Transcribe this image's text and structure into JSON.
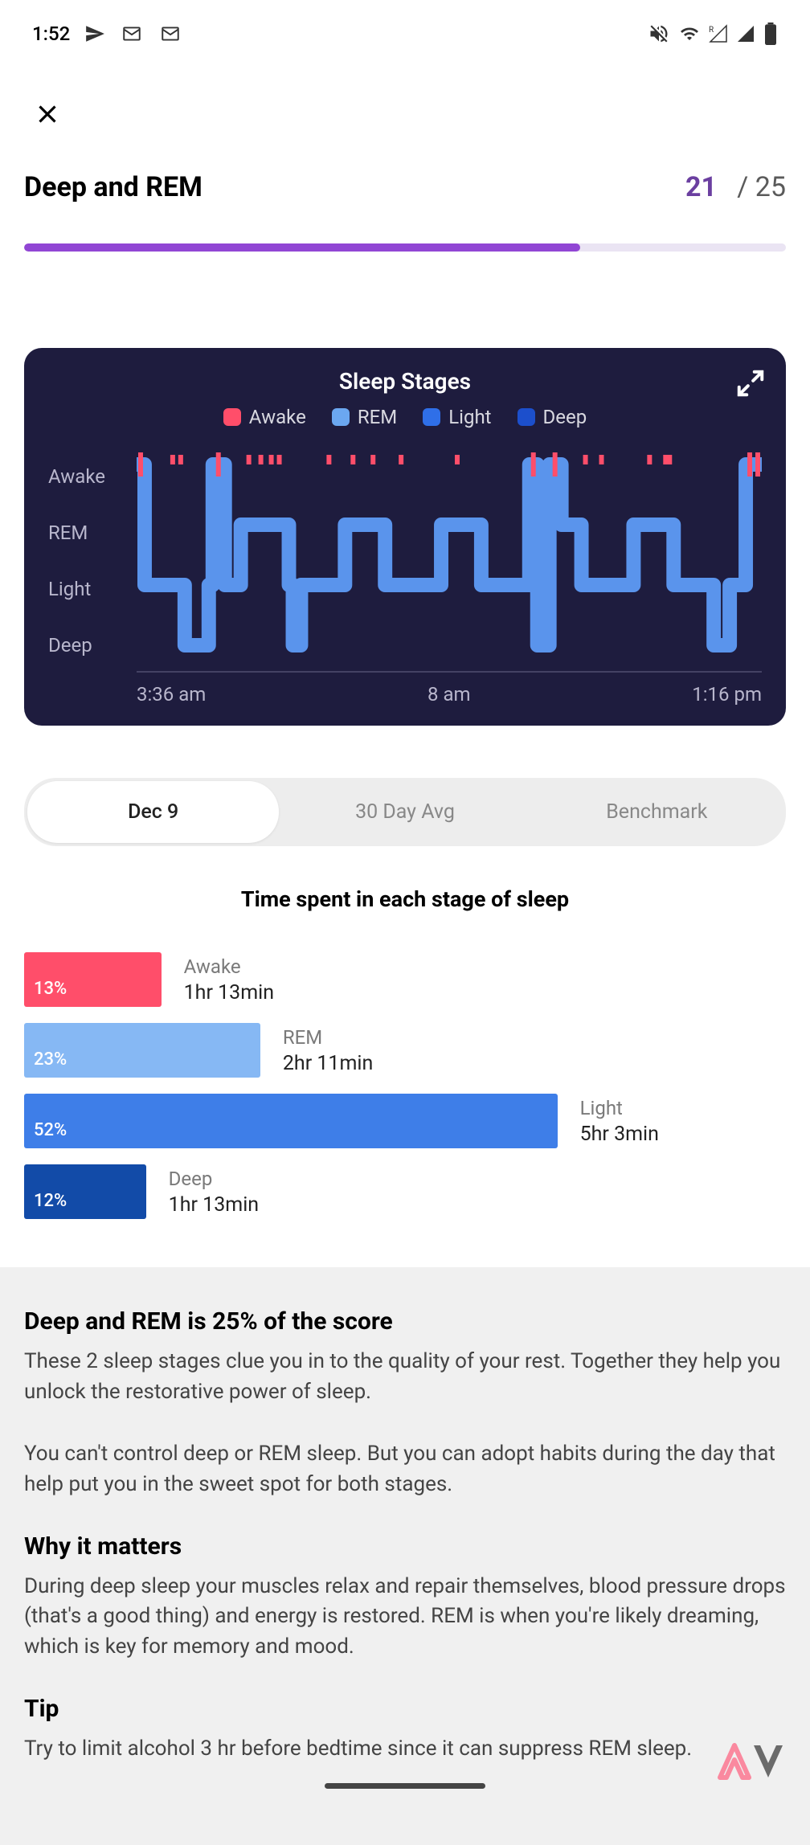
{
  "status": {
    "time": "1:52"
  },
  "header": {
    "title": "Deep and REM",
    "score_num": "21",
    "score_sep": "/",
    "score_total": "25",
    "progress_pct": 73
  },
  "chart": {
    "title": "Sleep Stages",
    "legend": {
      "awake": "Awake",
      "rem": "REM",
      "light": "Light",
      "deep": "Deep"
    },
    "y_labels": {
      "awake": "Awake",
      "rem": "REM",
      "light": "Light",
      "deep": "Deep"
    },
    "x_labels": {
      "start": "3:36 am",
      "mid": "8 am",
      "end": "1:16 pm"
    },
    "colors": {
      "awake": "#FF4E6A",
      "rem": "#86B8F4",
      "light": "#3E7EE8",
      "deep": "#1C4FCC"
    }
  },
  "tabs": {
    "a": "Dec 9",
    "b": "30 Day Avg",
    "c": "Benchmark"
  },
  "section_heading": "Time spent in each stage of sleep",
  "stages": {
    "awake": {
      "pct": "13%",
      "name": "Awake",
      "time": "1hr 13min",
      "width": 18,
      "color": "#FF4E6A"
    },
    "rem": {
      "pct": "23%",
      "name": "REM",
      "time": "2hr 11min",
      "width": 31,
      "color": "#86B8F4"
    },
    "light": {
      "pct": "52%",
      "name": "Light",
      "time": "5hr 3min",
      "width": 70,
      "color": "#3E7EE8"
    },
    "deep": {
      "pct": "12%",
      "name": "Deep",
      "time": "1hr 13min",
      "width": 16,
      "color": "#124BA8"
    }
  },
  "info": {
    "h1": "Deep and REM is 25% of the score",
    "p1": "These 2 sleep stages clue you in to the quality of your rest. Together they help you unlock the restorative power of sleep.",
    "p2": "You can't control deep or REM sleep. But you can adopt habits during the day that help put you in the sweet spot for both stages.",
    "h2": "Why it matters",
    "p3": "During deep sleep your muscles relax and repair themselves, blood pressure drops (that's a good thing) and energy is restored. REM is when you're likely dreaming, which is key for memory and mood.",
    "h3": "Tip",
    "p4": "Try to limit alcohol 3 hr before bedtime since it can suppress REM sleep."
  },
  "chart_data": {
    "type": "line",
    "title": "Sleep Stages",
    "y_categories": [
      "Awake",
      "REM",
      "Light",
      "Deep"
    ],
    "x_range": [
      "3:36 am",
      "1:16 pm"
    ],
    "colors": {
      "Awake": "#FF4E6A",
      "REM": "#86B8F4",
      "Light": "#3E7EE8",
      "Deep": "#1C4FCC"
    },
    "time_percent": {
      "Awake": 13,
      "REM": 23,
      "Light": 52,
      "Deep": 12
    },
    "duration": {
      "Awake": "1hr 13min",
      "REM": "2hr 11min",
      "Light": "5hr 3min",
      "Deep": "1hr 13min"
    }
  }
}
